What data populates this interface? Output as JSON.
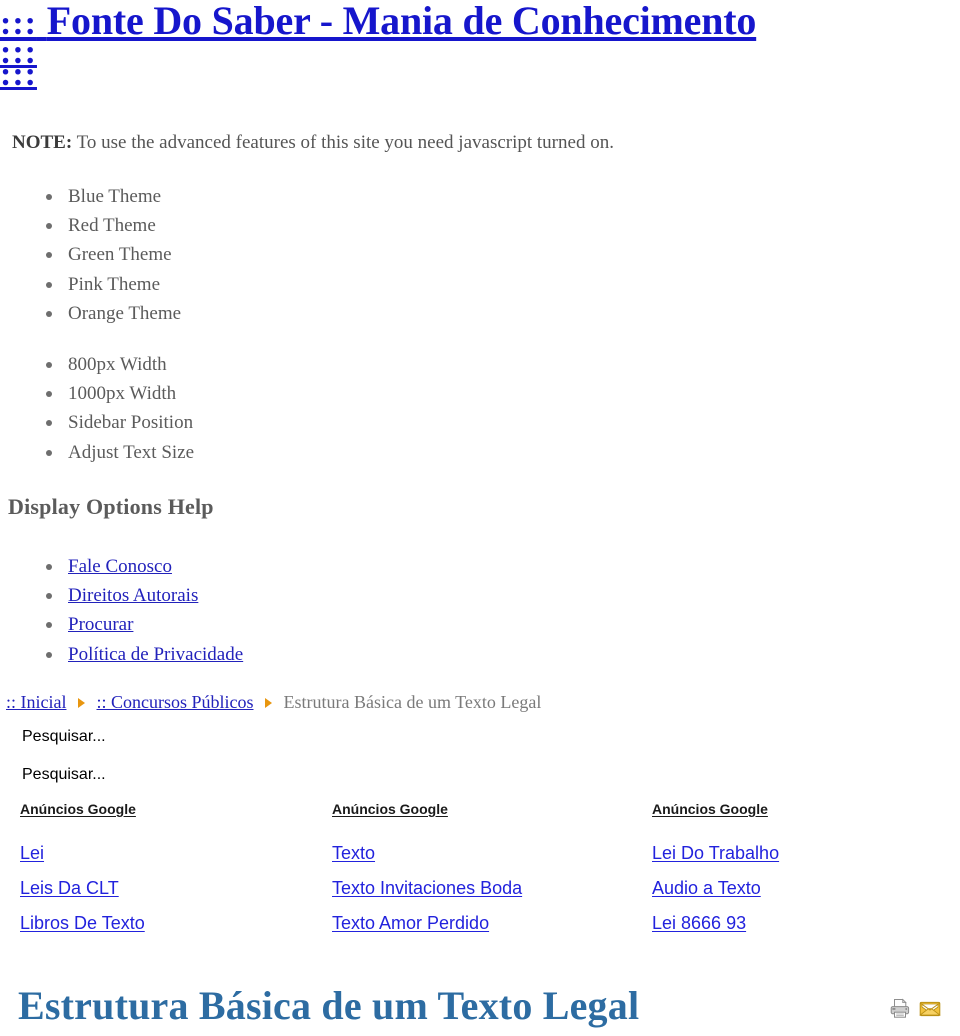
{
  "site": {
    "title_prefix": ":::",
    "title": "Fonte Do Saber - Mania de Conhecimento",
    "dots_line1": ":::",
    "dots_line2": ":::"
  },
  "note": {
    "label": "NOTE:",
    "text": " To use the advanced features of this site you need javascript turned on."
  },
  "themes": {
    "items": [
      {
        "label": "Blue Theme"
      },
      {
        "label": "Red Theme"
      },
      {
        "label": "Green Theme"
      },
      {
        "label": "Pink Theme"
      },
      {
        "label": "Orange Theme"
      }
    ]
  },
  "widths": {
    "items": [
      {
        "label": "800px Width"
      },
      {
        "label": "1000px Width"
      },
      {
        "label": "Sidebar Position"
      },
      {
        "label": "Adjust Text Size"
      }
    ]
  },
  "display_options": {
    "heading": "Display Options Help"
  },
  "help_links": {
    "items": [
      {
        "label": "Fale Conosco"
      },
      {
        "label": "Direitos Autorais"
      },
      {
        "label": "Procurar"
      },
      {
        "label": "Política de Privacidade"
      }
    ]
  },
  "breadcrumb": {
    "home": ":: Inicial",
    "section": ":: Concursos Públicos",
    "current": "Estrutura Básica de um Texto Legal"
  },
  "search": {
    "placeholder_1": "Pesquisar...",
    "placeholder_2": "Pesquisar..."
  },
  "ads": {
    "columns": [
      {
        "header": "Anúncios Google",
        "links": [
          {
            "label": "Lei"
          },
          {
            "label": "Leis Da CLT"
          },
          {
            "label": "Libros De Texto"
          }
        ]
      },
      {
        "header": "Anúncios Google",
        "links": [
          {
            "label": "Texto"
          },
          {
            "label": "Texto Invitaciones Boda"
          },
          {
            "label": "Texto Amor Perdido"
          }
        ]
      },
      {
        "header": "Anúncios Google",
        "links": [
          {
            "label": "Lei Do Trabalho"
          },
          {
            "label": "Audio a Texto"
          },
          {
            "label": "Lei 8666 93"
          }
        ]
      }
    ]
  },
  "article": {
    "heading": "Estrutura Básica de um Texto Legal"
  },
  "actions": {
    "print_icon": "printer-icon",
    "mail_icon": "envelope-icon"
  },
  "colors": {
    "link_blue": "#2222bb",
    "title_blue": "#1616cc",
    "heading_steel_blue": "#2d6ca2",
    "body_gray": "#5b5b5b",
    "crumb_arrow_orange": "#e8960f"
  }
}
